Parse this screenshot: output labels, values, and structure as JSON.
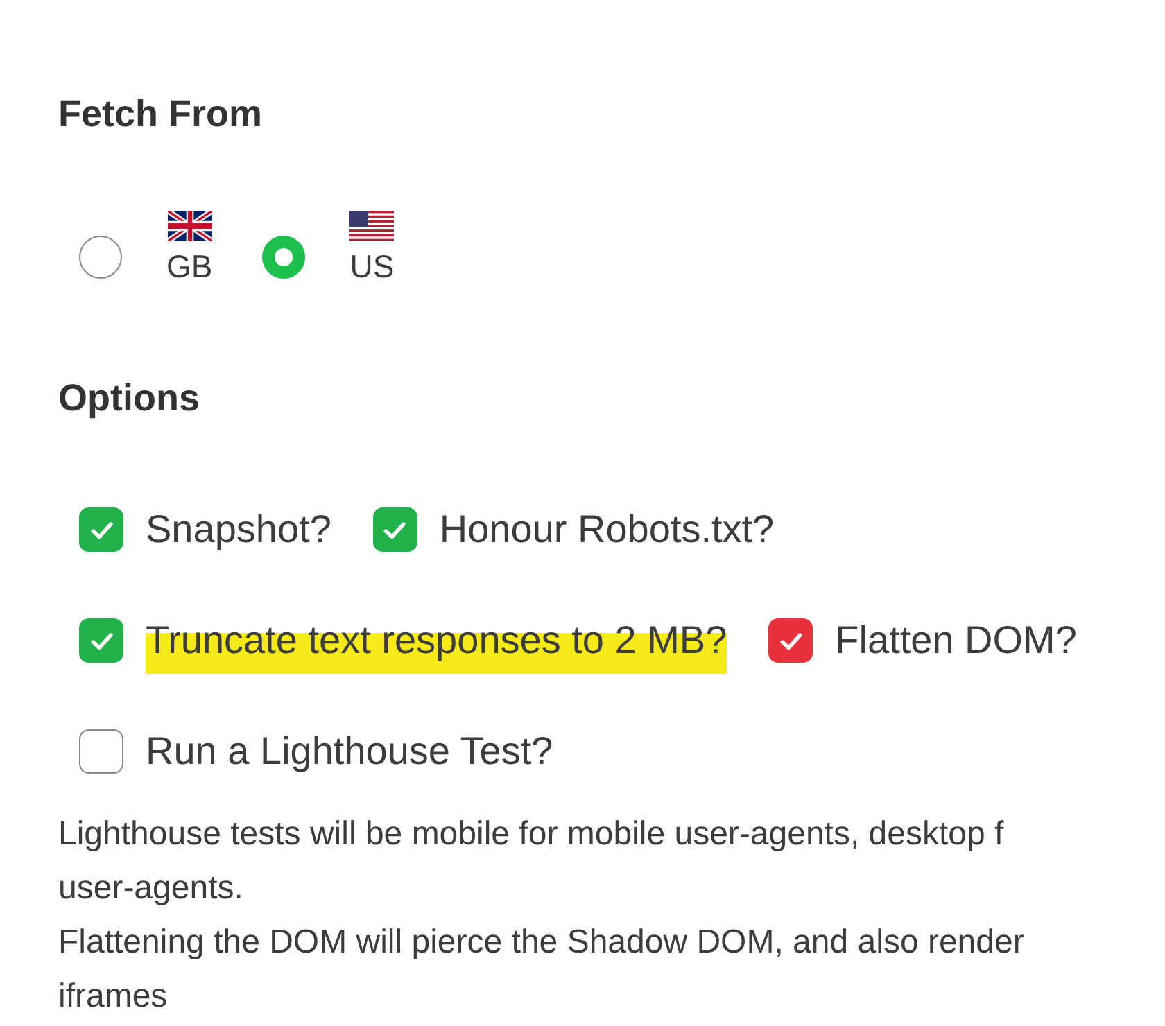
{
  "fetch_from": {
    "title": "Fetch From",
    "options": [
      {
        "label": "GB",
        "kind": "unionjack",
        "selected": false
      },
      {
        "label": "US",
        "kind": "starsstripes",
        "selected": true
      }
    ]
  },
  "options": {
    "title": "Options",
    "rows": [
      {
        "items": [
          {
            "label": "Snapshot?",
            "checked": true,
            "color": "#22b24c",
            "highlighted": false
          },
          {
            "label": "Honour Robots.txt?",
            "checked": true,
            "color": "#22b24c",
            "highlighted": false
          }
        ]
      },
      {
        "items": [
          {
            "label": "Truncate text responses to 2 MB?",
            "checked": true,
            "color": "#22b24c",
            "highlighted": true
          },
          {
            "label": "Flatten DOM?",
            "checked": true,
            "color": "#e8313c",
            "highlighted": false
          }
        ]
      },
      {
        "items": [
          {
            "label": "Run a Lighthouse Test?",
            "checked": false,
            "highlighted": false
          }
        ]
      }
    ]
  },
  "notes": [
    {
      "lines": [
        "Lighthouse tests will be mobile for mobile user-agents, desktop f",
        "user-agents."
      ]
    },
    {
      "lines": [
        "Flattening the DOM will pierce the Shadow DOM, and also render",
        "iframes"
      ]
    }
  ]
}
